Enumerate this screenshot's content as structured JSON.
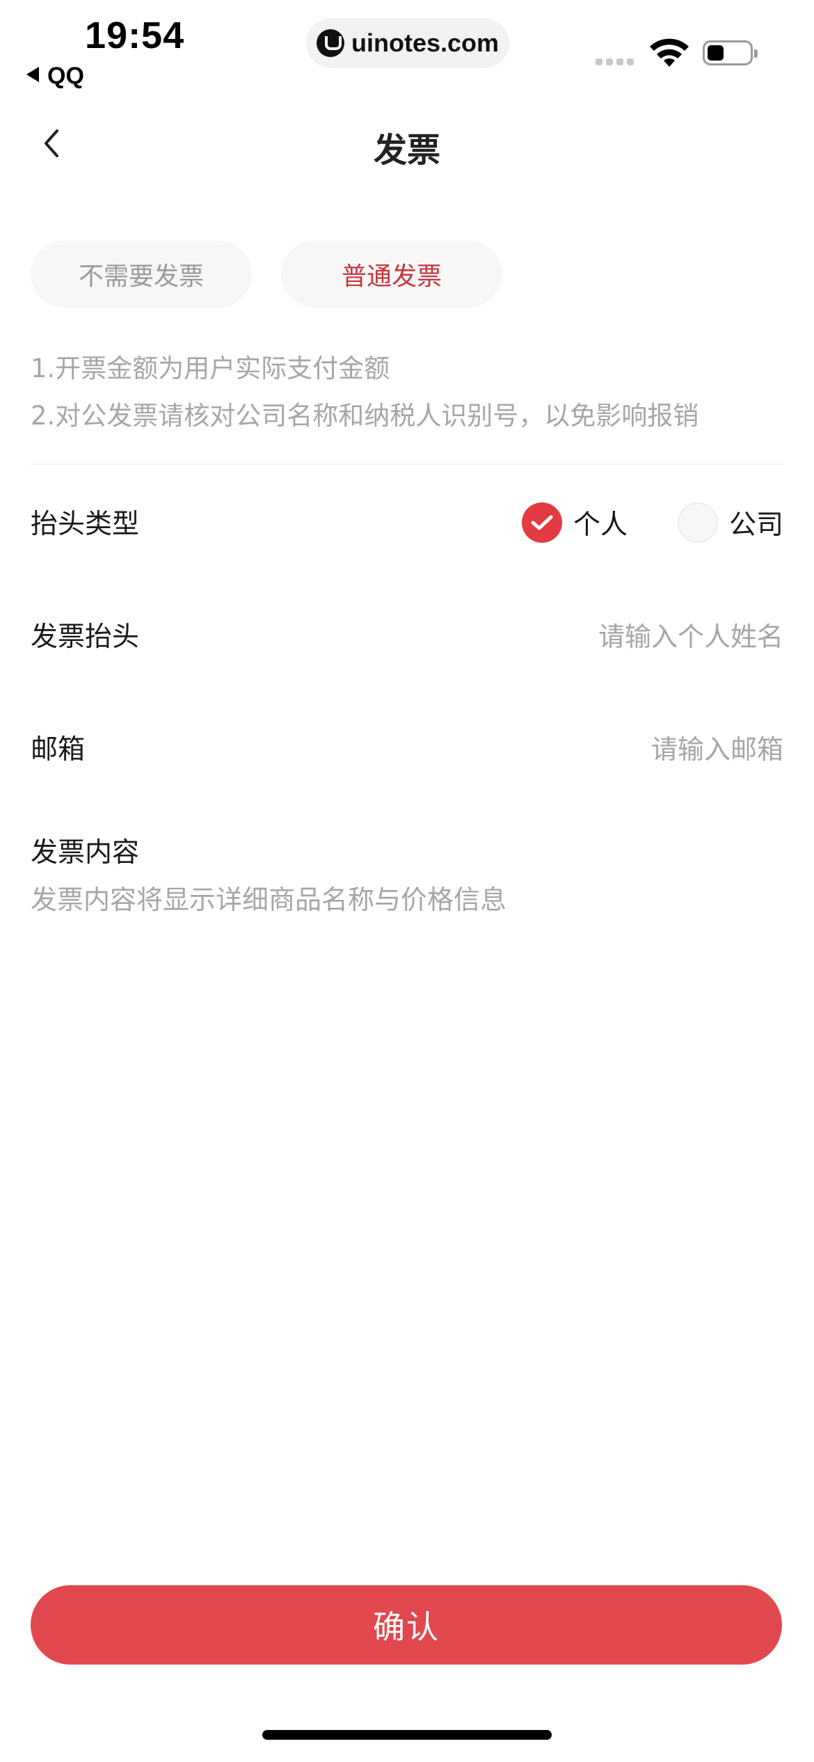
{
  "status_bar": {
    "time": "19:54",
    "back_app": "QQ",
    "url": "uinotes.com",
    "battery_level": 0.4
  },
  "nav": {
    "title": "发票",
    "back_icon": "chevron-left-icon"
  },
  "invoice_tabs": [
    {
      "label": "不需要发票",
      "selected": false
    },
    {
      "label": "普通发票",
      "selected": true
    }
  ],
  "notes": [
    "1.开票金额为用户实际支付金额",
    "2.对公发票请核对公司名称和纳税人识别号，以免影响报销"
  ],
  "form": {
    "title_type": {
      "label": "抬头类型",
      "options": [
        {
          "label": "个人",
          "checked": true
        },
        {
          "label": "公司",
          "checked": false
        }
      ]
    },
    "invoice_title": {
      "label": "发票抬头",
      "placeholder": "请输入个人姓名"
    },
    "email": {
      "label": "邮箱",
      "placeholder": "请输入邮箱"
    },
    "content": {
      "label": "发票内容",
      "description": "发票内容将显示详细商品名称与价格信息"
    }
  },
  "confirm_label": "确认",
  "colors": {
    "accent": "#e1484d",
    "radio_checked": "#e43a42",
    "selected_tab_text": "#c9353d",
    "placeholder": "#a6a6a6"
  }
}
